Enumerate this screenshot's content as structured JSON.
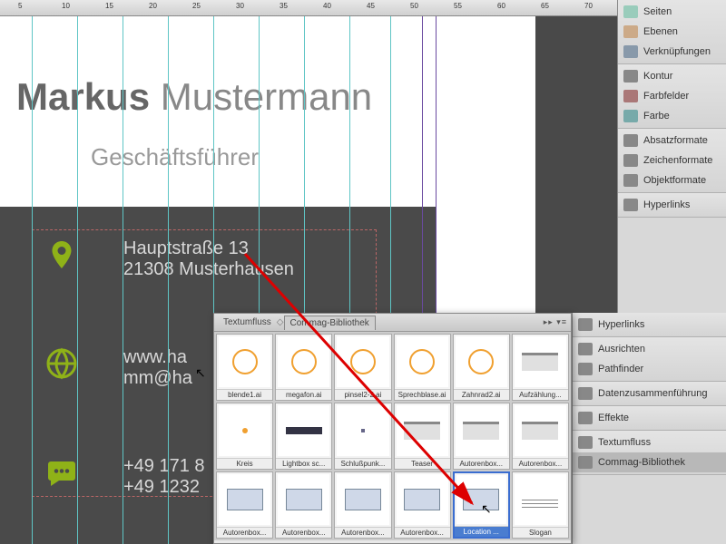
{
  "ruler_marks": [
    "5",
    "10",
    "15",
    "20",
    "25",
    "30",
    "35",
    "40",
    "45",
    "50",
    "55",
    "60",
    "65",
    "70"
  ],
  "card": {
    "first_name": "Markus",
    "last_name": "Mustermann",
    "title": "Geschäftsführer",
    "address_line1": "Hauptstraße 13",
    "address_line2": "21308 Musterhausen",
    "web": "www.ha",
    "email": "mm@ha",
    "phone1": "+49 171 8",
    "phone2": "+49 1232"
  },
  "library": {
    "tab1": "Textumfluss",
    "tab2": "Commag-Bibliothek",
    "items": [
      {
        "label": "blende1.ai",
        "kind": "ic"
      },
      {
        "label": "megafon.ai",
        "kind": "ic"
      },
      {
        "label": "pinsel2-2.ai",
        "kind": "ic"
      },
      {
        "label": "Sprechblase.ai",
        "kind": "ic"
      },
      {
        "label": "Zahnrad2.ai",
        "kind": "ic"
      },
      {
        "label": "Aufzählung...",
        "kind": "box"
      },
      {
        "label": "Kreis",
        "kind": "dot"
      },
      {
        "label": "Lightbox sc...",
        "kind": "bar"
      },
      {
        "label": "Schlußpunk...",
        "kind": "dot2"
      },
      {
        "label": "Teaser",
        "kind": "box"
      },
      {
        "label": "Autorenbox...",
        "kind": "box"
      },
      {
        "label": "Autorenbox...",
        "kind": "box"
      },
      {
        "label": "Autorenbox...",
        "kind": "box2"
      },
      {
        "label": "Autorenbox...",
        "kind": "box2"
      },
      {
        "label": "Autorenbox...",
        "kind": "box2"
      },
      {
        "label": "Autorenbox...",
        "kind": "box2"
      },
      {
        "label": "Location ...",
        "kind": "box2",
        "selected": true
      },
      {
        "label": "Slogan",
        "kind": "line"
      }
    ]
  },
  "panels_right": [
    [
      {
        "l": "Seiten",
        "i": "#9cb"
      },
      {
        "l": "Ebenen",
        "i": "#ca8"
      },
      {
        "l": "Verknüpfungen",
        "i": "#89a"
      }
    ],
    [
      {
        "l": "Kontur",
        "i": "#888"
      },
      {
        "l": "Farbfelder",
        "i": "#a77"
      },
      {
        "l": "Farbe",
        "i": "#7aa"
      }
    ],
    [
      {
        "l": "Absatzformate",
        "i": "#888"
      },
      {
        "l": "Zeichenformate",
        "i": "#888"
      },
      {
        "l": "Objektformate",
        "i": "#888"
      }
    ],
    [
      {
        "l": "Hyperlinks",
        "i": "#888"
      }
    ]
  ],
  "panels_right2": [
    [
      {
        "l": "Hyperlinks",
        "i": "#888"
      }
    ],
    [
      {
        "l": "Ausrichten",
        "i": "#888"
      },
      {
        "l": "Pathfinder",
        "i": "#888"
      }
    ],
    [
      {
        "l": "Datenzusammenführung",
        "i": "#888"
      }
    ],
    [
      {
        "l": "Effekte",
        "i": "#888"
      }
    ],
    [
      {
        "l": "Textumfluss",
        "i": "#888"
      },
      {
        "l": "Commag-Bibliothek",
        "i": "#888",
        "active": true
      }
    ]
  ]
}
